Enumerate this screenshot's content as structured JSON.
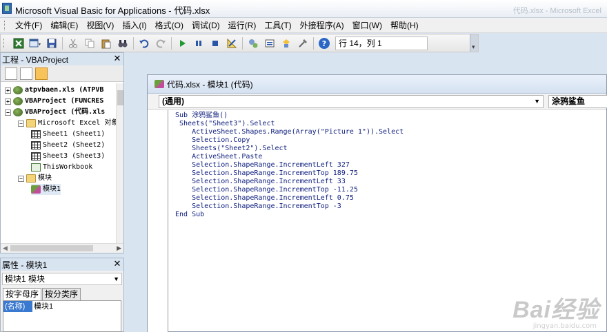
{
  "window": {
    "title": "Microsoft Visual Basic for Applications - 代码.xlsx",
    "ghost_title": "代码.xlsx - Microsoft Excel"
  },
  "menu": [
    "文件(F)",
    "编辑(E)",
    "视图(V)",
    "插入(I)",
    "格式(O)",
    "调试(D)",
    "运行(R)",
    "工具(T)",
    "外接程序(A)",
    "窗口(W)",
    "帮助(H)"
  ],
  "toolbar": {
    "position": "行 14，列 1"
  },
  "project": {
    "title": "工程 - VBAProject",
    "nodes": [
      {
        "label": "atpvbaen.xls (ATPVB",
        "level": 0,
        "expander": "+",
        "icon": "vba-project-icon"
      },
      {
        "label": "VBAProject (FUNCRES",
        "level": 0,
        "expander": "+",
        "icon": "vba-project-icon"
      },
      {
        "label": "VBAProject (代码.xls",
        "level": 0,
        "expander": "-",
        "icon": "vba-project-icon"
      },
      {
        "label": "Microsoft Excel 对象",
        "level": 1,
        "expander": "-",
        "icon": "folder-icon"
      },
      {
        "label": "Sheet1 (Sheet1)",
        "level": 2,
        "expander": "",
        "icon": "sheet-icon"
      },
      {
        "label": "Sheet2 (Sheet2)",
        "level": 2,
        "expander": "",
        "icon": "sheet-icon"
      },
      {
        "label": "Sheet3 (Sheet3)",
        "level": 2,
        "expander": "",
        "icon": "sheet-icon"
      },
      {
        "label": "ThisWorkbook",
        "level": 2,
        "expander": "",
        "icon": "workbook-icon"
      },
      {
        "label": "模块",
        "level": 1,
        "expander": "-",
        "icon": "folder-icon"
      },
      {
        "label": "模块1",
        "level": 2,
        "expander": "",
        "icon": "module-icon"
      }
    ]
  },
  "properties": {
    "title": "属性 - 模块1",
    "object": "模块1 模块",
    "tabs": [
      "按字母序",
      "按分类序"
    ],
    "rows": [
      {
        "name": "(名称)",
        "value": "模块1"
      }
    ]
  },
  "code_window": {
    "title": "代码.xlsx - 模块1 (代码)",
    "object_combo": "(通用)",
    "proc_combo": "涂鸦鲨鱼",
    "lines": [
      "Sub 涂鸦鲨鱼()",
      " Sheets(\"Sheet3\").Select",
      "    ActiveSheet.Shapes.Range(Array(\"Picture 1\")).Select",
      "    Selection.Copy",
      "    Sheets(\"Sheet2\").Select",
      "    ActiveSheet.Paste",
      "    Selection.ShapeRange.IncrementLeft 327",
      "    Selection.ShapeRange.IncrementTop 189.75",
      "    Selection.ShapeRange.IncrementLeft 33",
      "    Selection.ShapeRange.IncrementTop -11.25",
      "    Selection.ShapeRange.IncrementLeft 0.75",
      "    Selection.ShapeRange.IncrementTop -3",
      "End Sub"
    ]
  },
  "watermark": {
    "brand": "Bai经验",
    "url": "jingyan.baidu.com"
  }
}
